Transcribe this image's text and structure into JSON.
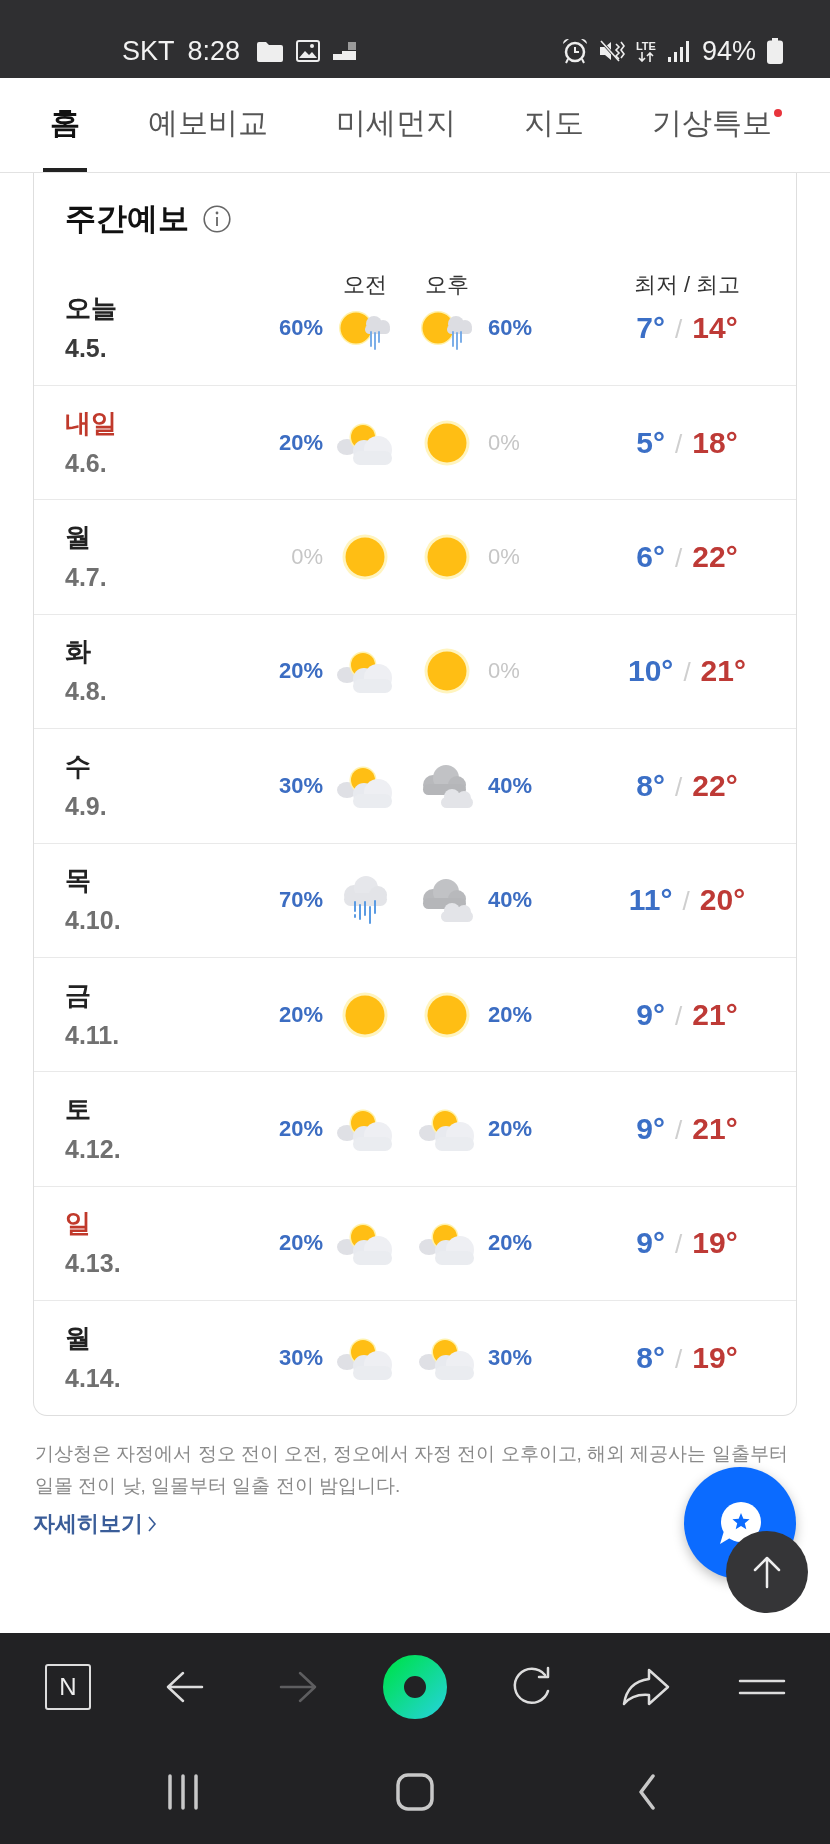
{
  "status_bar": {
    "carrier": "SKT",
    "time": "8:28",
    "network": "LTE",
    "battery": "94%"
  },
  "tabs": [
    {
      "label": "홈",
      "selected": true,
      "alert": false
    },
    {
      "label": "예보비교",
      "selected": false,
      "alert": false
    },
    {
      "label": "미세먼지",
      "selected": false,
      "alert": false
    },
    {
      "label": "지도",
      "selected": false,
      "alert": false
    },
    {
      "label": "기상특보",
      "selected": false,
      "alert": true
    }
  ],
  "forecast": {
    "title": "주간예보",
    "headers": {
      "am": "오전",
      "pm": "오후",
      "temps": "최저 / 최고"
    },
    "days": [
      {
        "day": "오늘",
        "date": "4.5.",
        "today": true,
        "sunday": false,
        "am": {
          "kind": "sun-rain",
          "pct": "60%",
          "muted": false
        },
        "pm": {
          "kind": "sun-rain",
          "pct": "60%",
          "muted": false
        },
        "low": "7°",
        "sep": "/",
        "high": "14°"
      },
      {
        "day": "내일",
        "date": "4.6.",
        "today": false,
        "sunday": true,
        "am": {
          "kind": "sun-cloud",
          "pct": "20%",
          "muted": false
        },
        "pm": {
          "kind": "sun",
          "pct": "0%",
          "muted": true
        },
        "low": "5°",
        "sep": "/",
        "high": "18°"
      },
      {
        "day": "월",
        "date": "4.7.",
        "today": false,
        "sunday": false,
        "am": {
          "kind": "sun",
          "pct": "0%",
          "muted": true
        },
        "pm": {
          "kind": "sun",
          "pct": "0%",
          "muted": true
        },
        "low": "6°",
        "sep": "/",
        "high": "22°"
      },
      {
        "day": "화",
        "date": "4.8.",
        "today": false,
        "sunday": false,
        "am": {
          "kind": "sun-cloud",
          "pct": "20%",
          "muted": false
        },
        "pm": {
          "kind": "sun",
          "pct": "0%",
          "muted": true
        },
        "low": "10°",
        "sep": "/",
        "high": "21°"
      },
      {
        "day": "수",
        "date": "4.9.",
        "today": false,
        "sunday": false,
        "am": {
          "kind": "sun-cloud",
          "pct": "30%",
          "muted": false
        },
        "pm": {
          "kind": "clouds",
          "pct": "40%",
          "muted": false
        },
        "low": "8°",
        "sep": "/",
        "high": "22°"
      },
      {
        "day": "목",
        "date": "4.10.",
        "today": false,
        "sunday": false,
        "am": {
          "kind": "rain",
          "pct": "70%",
          "muted": false
        },
        "pm": {
          "kind": "clouds",
          "pct": "40%",
          "muted": false
        },
        "low": "11°",
        "sep": "/",
        "high": "20°"
      },
      {
        "day": "금",
        "date": "4.11.",
        "today": false,
        "sunday": false,
        "am": {
          "kind": "sun",
          "pct": "20%",
          "muted": false
        },
        "pm": {
          "kind": "sun",
          "pct": "20%",
          "muted": false
        },
        "low": "9°",
        "sep": "/",
        "high": "21°"
      },
      {
        "day": "토",
        "date": "4.12.",
        "today": false,
        "sunday": false,
        "am": {
          "kind": "sun-cloud",
          "pct": "20%",
          "muted": false
        },
        "pm": {
          "kind": "sun-cloud",
          "pct": "20%",
          "muted": false
        },
        "low": "9°",
        "sep": "/",
        "high": "21°"
      },
      {
        "day": "일",
        "date": "4.13.",
        "today": false,
        "sunday": true,
        "am": {
          "kind": "sun-cloud",
          "pct": "20%",
          "muted": false
        },
        "pm": {
          "kind": "sun-cloud",
          "pct": "20%",
          "muted": false
        },
        "low": "9°",
        "sep": "/",
        "high": "19°"
      },
      {
        "day": "월",
        "date": "4.14.",
        "today": false,
        "sunday": false,
        "am": {
          "kind": "sun-cloud",
          "pct": "30%",
          "muted": false
        },
        "pm": {
          "kind": "sun-cloud",
          "pct": "30%",
          "muted": false
        },
        "low": "8°",
        "sep": "/",
        "high": "19°"
      }
    ]
  },
  "note": "기상청은 자정에서 정오 전이 오전, 정오에서 자정 전이 오후이고, 해외 제공사는 일출부터 일몰 전이 낮, 일몰부터 일출 전이 밤입니다.",
  "more_link": "자세히보기",
  "browser_bar": {
    "home_label": "N",
    "forward_enabled": false
  }
}
